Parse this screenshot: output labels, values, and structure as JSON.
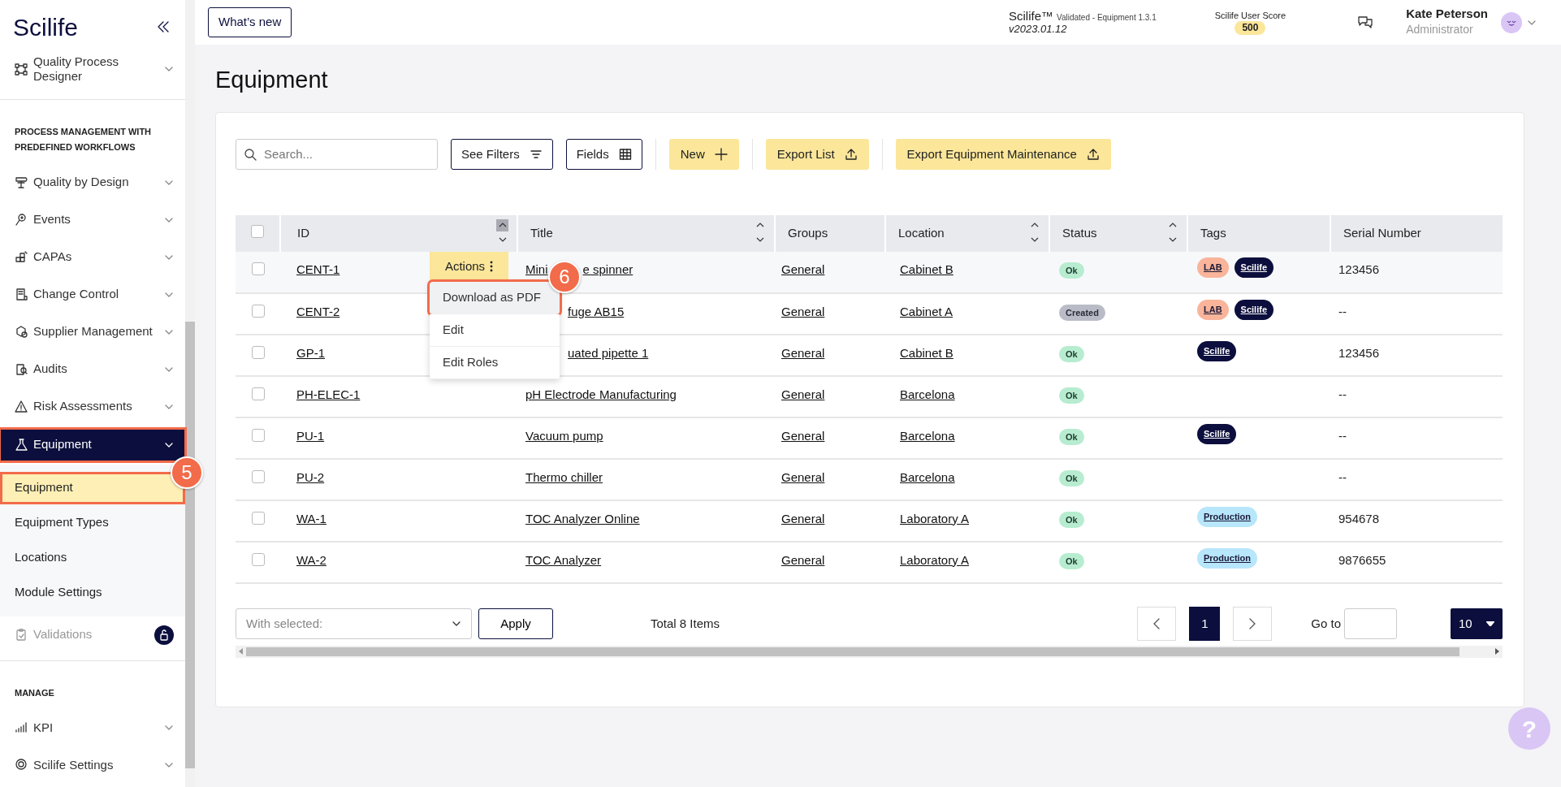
{
  "topbar": {
    "logo": "Scilife",
    "whats_new": "What’s new",
    "product": "Scilife™",
    "validated": "Validated - Equipment 1.3.1",
    "version": "v2023.01.12",
    "score_label": "Scilife User Score",
    "score": "500",
    "user_name": "Kate Peterson",
    "user_role": "Administrator"
  },
  "sidebar": {
    "items": [
      {
        "kind": "item",
        "label": "Quality Process Designer",
        "selected": false
      },
      {
        "kind": "section",
        "label": "PROCESS MANAGEMENT WITH PREDEFINED WORKFLOWS"
      },
      {
        "kind": "item",
        "label": "Quality by Design",
        "selected": false
      },
      {
        "kind": "item",
        "label": "Events",
        "selected": false
      },
      {
        "kind": "item",
        "label": "CAPAs",
        "selected": false
      },
      {
        "kind": "item",
        "label": "Change Control",
        "selected": false
      },
      {
        "kind": "item",
        "label": "Supplier Management",
        "selected": false
      },
      {
        "kind": "item",
        "label": "Audits",
        "selected": false
      },
      {
        "kind": "item",
        "label": "Risk Assessments",
        "selected": false
      },
      {
        "kind": "item",
        "label": "Equipment",
        "selected": true,
        "highlighted": true,
        "step": "5",
        "children": [
          {
            "label": "Equipment",
            "selected": true,
            "highlighted": true
          },
          {
            "label": "Equipment Types",
            "selected": false,
            "highlighted": false
          },
          {
            "label": "Locations",
            "selected": false,
            "highlighted": false
          },
          {
            "label": "Module Settings",
            "selected": false,
            "highlighted": false
          }
        ]
      },
      {
        "kind": "locked",
        "label": "Validations",
        "disabled": true
      },
      {
        "kind": "section",
        "label": "MANAGE"
      },
      {
        "kind": "item",
        "label": "KPI",
        "selected": false
      },
      {
        "kind": "item",
        "label": "Scilife Settings",
        "selected": false
      }
    ]
  },
  "page_title": "Equipment",
  "toolbar": {
    "search": {
      "placeholder": "Search..."
    },
    "buttons": [
      {
        "kind": "outline",
        "label": "See Filters"
      },
      {
        "kind": "outline",
        "label": "Fields"
      },
      {
        "kind": "primary",
        "label": "New"
      },
      {
        "kind": "primary",
        "label": "Export List"
      },
      {
        "kind": "primary",
        "label": "Export Equipment Maintenance"
      }
    ]
  },
  "table": {
    "select_all": {
      "checked": false
    },
    "columns": [
      {
        "label": "ID",
        "sort_active": true
      },
      {
        "label": "Title",
        "sort_active": false
      },
      {
        "label": "Groups"
      },
      {
        "label": "Location",
        "sort_active": false
      },
      {
        "label": "Status",
        "sort_active": false
      },
      {
        "label": "Tags"
      },
      {
        "label": "Serial Number"
      }
    ],
    "rows": [
      {
        "checked": false,
        "id": "CENT-1",
        "title_parts": [
          "Mini",
          "e spinner"
        ],
        "group": "General",
        "location": "Cabinet B",
        "status": {
          "label": "Ok",
          "kind": "ok"
        },
        "tags": [
          {
            "label": "LAB",
            "color": "#f9b49a"
          },
          {
            "label": "Scilife",
            "color": "#0c0f3d"
          }
        ],
        "serial": "123456",
        "actions": {
          "label": "Actions",
          "menu": [
            {
              "label": "Download as PDF",
              "highlighted": true,
              "step": "6"
            },
            {
              "label": "Edit",
              "highlighted": false
            },
            {
              "label": "Edit Roles",
              "highlighted": false
            }
          ]
        }
      },
      {
        "checked": false,
        "id": "CENT-2",
        "title_parts": [
          "fuge AB15"
        ],
        "group": "General",
        "location": "Cabinet A",
        "status": {
          "label": "Created",
          "kind": "created"
        },
        "tags": [
          {
            "label": "LAB",
            "color": "#f9b49a"
          },
          {
            "label": "Scilife",
            "color": "#0c0f3d"
          }
        ],
        "serial": "--"
      },
      {
        "checked": false,
        "id": "GP-1",
        "title_parts": [
          "uated pipette 1"
        ],
        "group": "General",
        "location": "Cabinet B",
        "status": {
          "label": "Ok",
          "kind": "ok"
        },
        "tags": [
          {
            "label": "Scilife",
            "color": "#0c0f3d"
          }
        ],
        "serial": "123456"
      },
      {
        "checked": false,
        "id": "PH-ELEC-1",
        "title_parts": [
          "pH Electrode Manufacturing"
        ],
        "group": "General",
        "location": "Barcelona",
        "status": {
          "label": "Ok",
          "kind": "ok"
        },
        "serial": "--"
      },
      {
        "checked": false,
        "id": "PU-1",
        "title_parts": [
          "Vacuum pump"
        ],
        "group": "General",
        "location": "Barcelona",
        "status": {
          "label": "Ok",
          "kind": "ok"
        },
        "tags": [
          {
            "label": "Scilife",
            "color": "#0c0f3d"
          }
        ],
        "serial": "--"
      },
      {
        "checked": false,
        "id": "PU-2",
        "title_parts": [
          "Thermo chiller"
        ],
        "group": "General",
        "location": "Barcelona",
        "status": {
          "label": "Ok",
          "kind": "ok"
        },
        "serial": "--"
      },
      {
        "checked": false,
        "id": "WA-1",
        "title_parts": [
          "TOC Analyzer Online"
        ],
        "group": "General",
        "location": "Laboratory A",
        "status": {
          "label": "Ok",
          "kind": "ok"
        },
        "tags": [
          {
            "label": "Production",
            "color": "#b8e6fb"
          }
        ],
        "serial": "954678"
      },
      {
        "checked": false,
        "id": "WA-2",
        "title_parts": [
          "TOC Analyzer"
        ],
        "group": "General",
        "location": "Laboratory A",
        "status": {
          "label": "Ok",
          "kind": "ok"
        },
        "tags": [
          {
            "label": "Production",
            "color": "#b8e6fb"
          }
        ],
        "serial": "9876655"
      }
    ]
  },
  "footer": {
    "bulk": {
      "placeholder": "With selected:"
    },
    "apply": "Apply",
    "total": "Total 8 Items",
    "pages": [
      {
        "label": "1",
        "selected": true
      }
    ],
    "goto_label": "Go to",
    "page_size": "10"
  },
  "help": "?"
}
